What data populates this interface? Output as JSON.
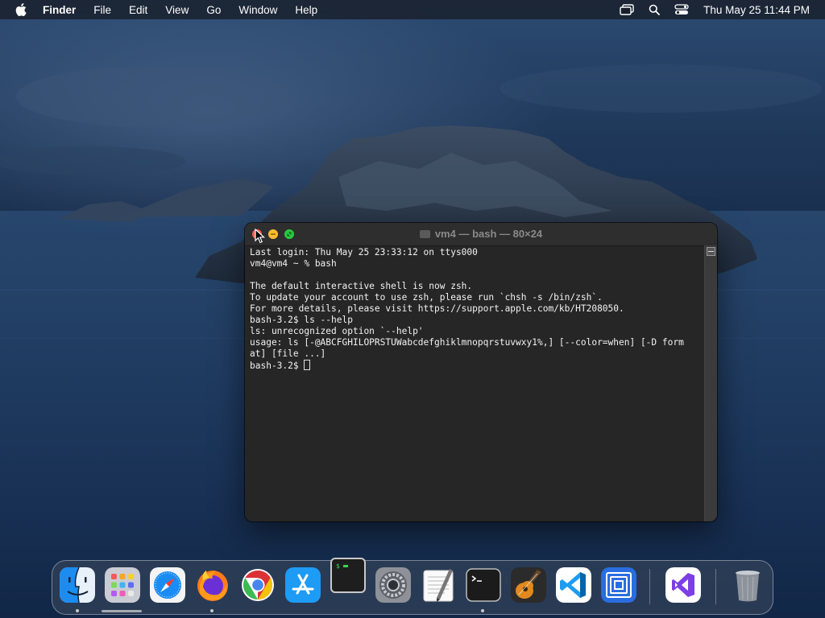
{
  "menubar": {
    "apple_icon": "apple-logo-icon",
    "app_name": "Finder",
    "menus": [
      "File",
      "Edit",
      "View",
      "Go",
      "Window",
      "Help"
    ],
    "status_icons": [
      "screen-mirroring-icon",
      "spotlight-search-icon",
      "control-center-icon"
    ],
    "clock": "Thu May 25  11:44 PM"
  },
  "terminal": {
    "title": "vm4 — bash — 80×24",
    "lines": [
      "Last login: Thu May 25 23:33:12 on ttys000",
      "vm4@vm4 ~ % bash",
      "",
      "The default interactive shell is now zsh.",
      "To update your account to use zsh, please run `chsh -s /bin/zsh`.",
      "For more details, please visit https://support.apple.com/kb/HT208050.",
      "bash-3.2$ ls --help",
      "ls: unrecognized option `--help'",
      "usage: ls [-@ABCFGHILOPRSTUWabcdefghiklmnopqrstuvwxy1%,] [--color=when] [-D form",
      "at] [file ...]",
      "bash-3.2$ "
    ]
  },
  "dock": {
    "items": [
      {
        "name": "Finder",
        "icon": "finder-icon",
        "running": true
      },
      {
        "name": "Launchpad",
        "icon": "launchpad-icon",
        "running": false
      },
      {
        "name": "Safari",
        "icon": "safari-icon",
        "running": false
      },
      {
        "name": "Firefox",
        "icon": "firefox-icon",
        "running": true
      },
      {
        "name": "Google Chrome",
        "icon": "chrome-icon",
        "running": false
      },
      {
        "name": "App Store",
        "icon": "app-store-icon",
        "running": false
      },
      {
        "name": "Terminal",
        "icon": "terminal-icon",
        "running": false
      },
      {
        "name": "System Preferences",
        "icon": "system-preferences-icon",
        "running": false
      },
      {
        "name": "TextEdit",
        "icon": "textedit-icon",
        "running": false
      },
      {
        "name": "Terminal",
        "icon": "terminal-icon",
        "running": true
      },
      {
        "name": "GarageBand",
        "icon": "garageband-icon",
        "running": false
      },
      {
        "name": "Visual Studio Code",
        "icon": "vscode-icon",
        "running": false
      },
      {
        "name": "Simulator",
        "icon": "simulator-icon",
        "running": false
      },
      {
        "name": "Visual Studio",
        "icon": "visual-studio-icon",
        "running": false
      },
      {
        "name": "Trash",
        "icon": "trash-icon",
        "running": false
      }
    ],
    "popup_text": "$"
  }
}
